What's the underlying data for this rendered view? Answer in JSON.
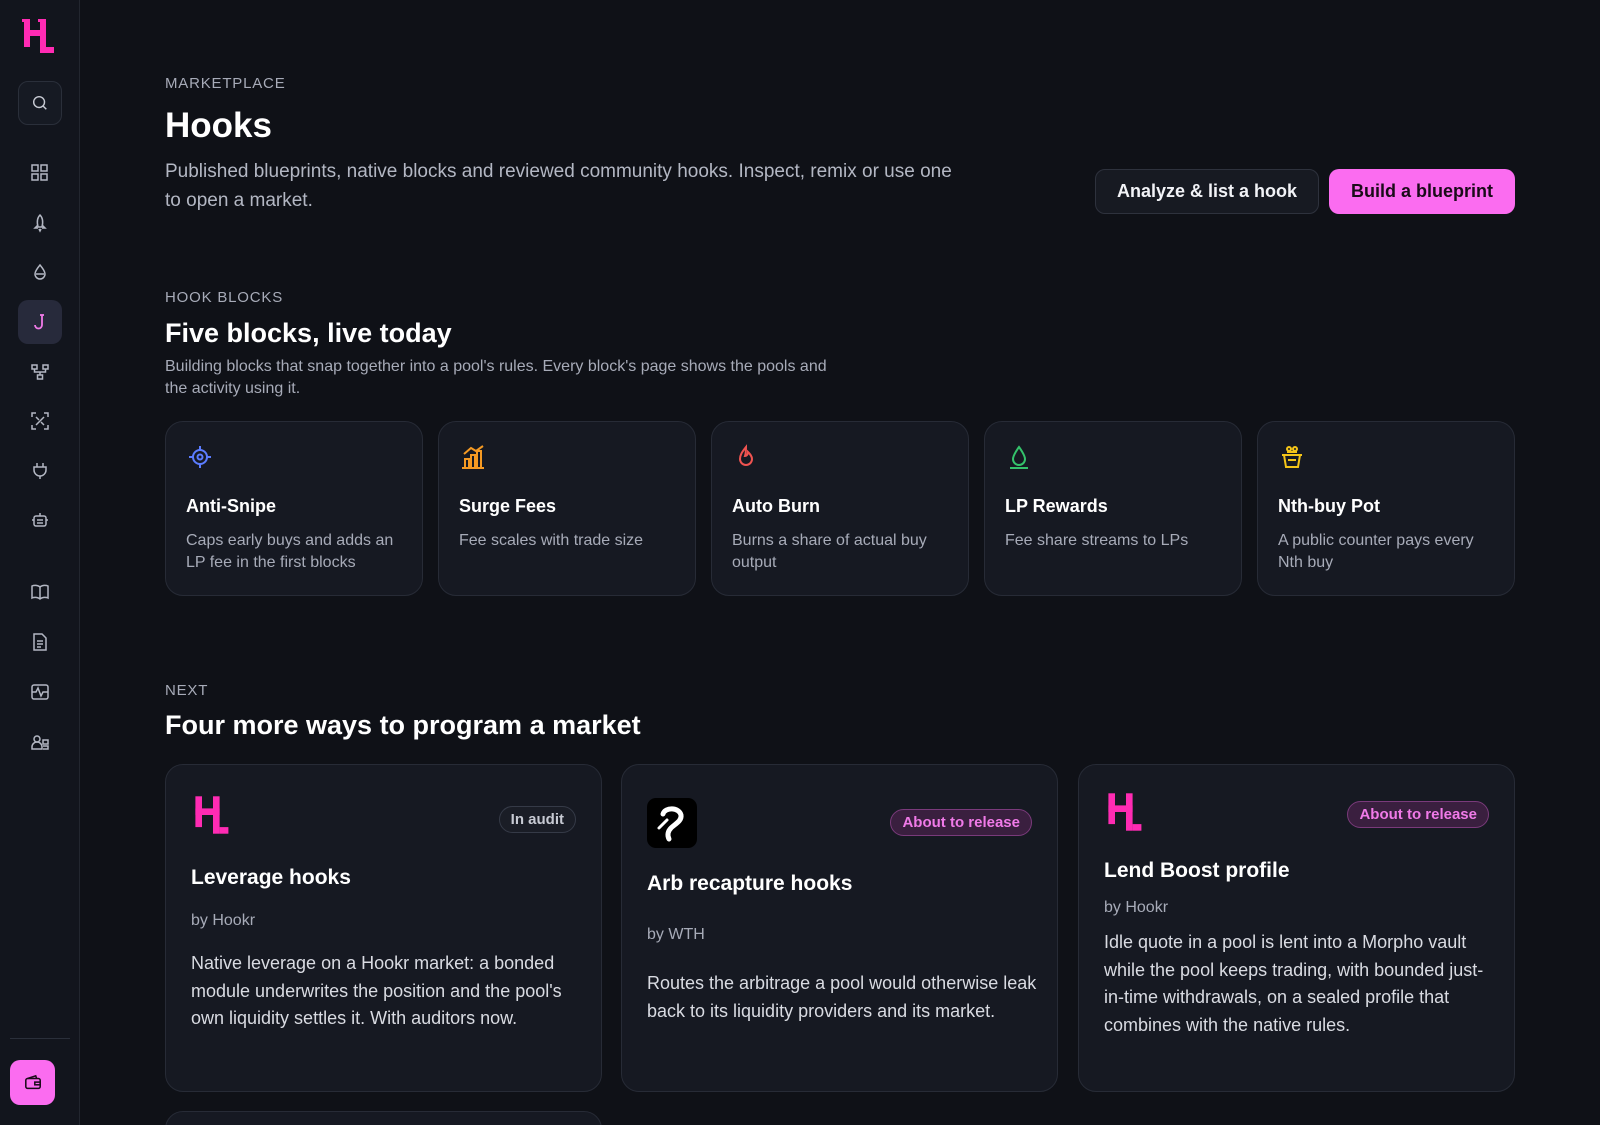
{
  "colors": {
    "accent": "#fb6cf0",
    "background": "#0f1117",
    "card": "#161922"
  },
  "sidebar": {
    "logo_icon": "hookr-logo-icon",
    "search_icon": "search-icon",
    "items": [
      {
        "icon": "dashboard-grid-icon"
      },
      {
        "icon": "rocket-icon"
      },
      {
        "icon": "drop-icon"
      },
      {
        "icon": "hook-icon",
        "active": true
      },
      {
        "icon": "blocks-network-icon"
      },
      {
        "icon": "scan-icon"
      },
      {
        "icon": "plug-icon"
      },
      {
        "icon": "robot-icon"
      },
      {
        "icon": "book-icon"
      },
      {
        "icon": "document-icon"
      },
      {
        "icon": "activity-icon"
      },
      {
        "icon": "users-icon"
      }
    ],
    "wallet_icon": "wallet-icon"
  },
  "header": {
    "eyebrow": "MARKETPLACE",
    "title": "Hooks",
    "description": "Published blueprints, native blocks and reviewed community hooks. Inspect, remix or use one to open a market.",
    "secondary_button": "Analyze & list a hook",
    "primary_button": "Build a blueprint"
  },
  "hook_blocks": {
    "eyebrow": "HOOK BLOCKS",
    "title": "Five blocks, live today",
    "description": "Building blocks that snap together into a pool's rules. Every block's page shows the pools and the activity using it.",
    "blocks": [
      {
        "icon": "crosshair-icon",
        "color": "#5b7cff",
        "title": "Anti-Snipe",
        "description": "Caps early buys and adds an LP fee in the first blocks"
      },
      {
        "icon": "bar-chart-icon",
        "color": "#f59a23",
        "title": "Surge Fees",
        "description": "Fee scales with trade size"
      },
      {
        "icon": "flame-icon",
        "color": "#ef5350",
        "title": "Auto Burn",
        "description": "Burns a share of actual buy output"
      },
      {
        "icon": "droplet-icon",
        "color": "#34c26b",
        "title": "LP Rewards",
        "description": "Fee share streams to LPs"
      },
      {
        "icon": "pot-icon",
        "color": "#f5c518",
        "title": "Nth-buy Pot",
        "description": "A public counter pays every Nth buy"
      }
    ]
  },
  "next": {
    "eyebrow": "NEXT",
    "title": "Four more ways to program a market",
    "cards": [
      {
        "logo": "hookr-logo-icon",
        "badge": "In audit",
        "badge_type": "audit",
        "title": "Leverage hooks",
        "by": "by Hookr",
        "description": "Native leverage on a Hookr market: a bonded module underwrites the position and the pool's own liquidity settles it. With auditors now."
      },
      {
        "logo": "wth-logo-icon",
        "badge": "About to release",
        "badge_type": "release",
        "title": "Arb recapture hooks",
        "by": "by WTH",
        "description": "Routes the arbitrage a pool would otherwise leak back to its liquidity providers and its market."
      },
      {
        "logo": "hookr-logo-icon",
        "badge": "About to release",
        "badge_type": "release",
        "title": "Lend Boost profile",
        "by": "by Hookr",
        "description": "Idle quote in a pool is lent into a Morpho vault while the pool keeps trading, with bounded just-in-time withdrawals, on a sealed profile that combines with the native rules."
      }
    ]
  }
}
